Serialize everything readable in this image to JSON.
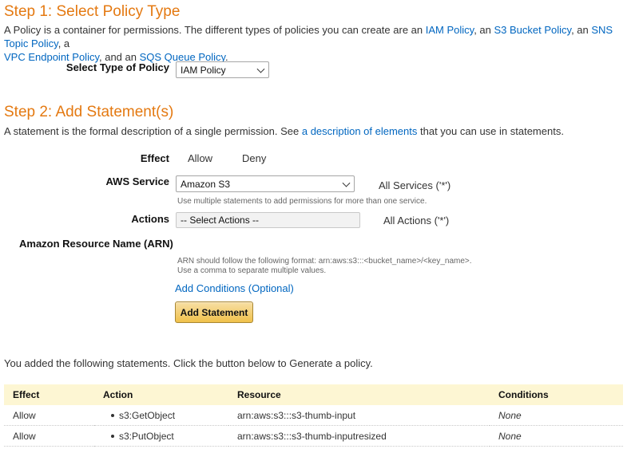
{
  "step1": {
    "title": "Step 1: Select Policy Type",
    "desc_prefix": "A Policy is a container for permissions. The different types of policies you can create are an ",
    "link_iam": "IAM Policy",
    "sep1": ", an ",
    "link_s3": "S3 Bucket Policy",
    "sep2": ", an ",
    "link_sns": "SNS Topic Policy",
    "sep3": ", a",
    "link_vpc": "VPC Endpoint Policy",
    "sep4": ", and an ",
    "link_sqs": "SQS Queue Policy",
    "desc_suffix": ".",
    "select_label": "Select Type of Policy",
    "select_value": "IAM Policy"
  },
  "step2": {
    "title": "Step 2: Add Statement(s)",
    "desc_prefix": "A statement is the formal description of a single permission. See ",
    "desc_link": "a description of elements",
    "desc_suffix": " that you can use in statements.",
    "effect_label": "Effect",
    "effect_allow": "Allow",
    "effect_deny": "Deny",
    "service_label": "AWS Service",
    "service_value": "Amazon S3",
    "all_services": "All Services ('*')",
    "service_hint": "Use multiple statements to add permissions for more than one service.",
    "actions_label": "Actions",
    "actions_value": "-- Select Actions --",
    "all_actions": "All Actions ('*')",
    "arn_label": "Amazon Resource Name (ARN)",
    "arn_hint1": "ARN should follow the following format: arn:aws:s3:::<bucket_name>/<key_name>.",
    "arn_hint2": "Use a comma to separate multiple values.",
    "add_conditions": "Add Conditions (Optional)",
    "add_statement": "Add Statement"
  },
  "added": {
    "message": "You added the following statements. Click the button below to Generate a policy.",
    "columns": [
      "Effect",
      "Action",
      "Resource",
      "Conditions"
    ],
    "rows": [
      {
        "effect": "Allow",
        "action": "s3:GetObject",
        "resource": "arn:aws:s3:::s3-thumb-input",
        "conditions": "None"
      },
      {
        "effect": "Allow",
        "action": "s3:PutObject",
        "resource": "arn:aws:s3:::s3-thumb-inputresized",
        "conditions": "None"
      }
    ]
  },
  "colors": {
    "heading": "#e47911",
    "link": "#0066c0",
    "button": "#f0c14b",
    "table_header": "#fdf6d3"
  }
}
